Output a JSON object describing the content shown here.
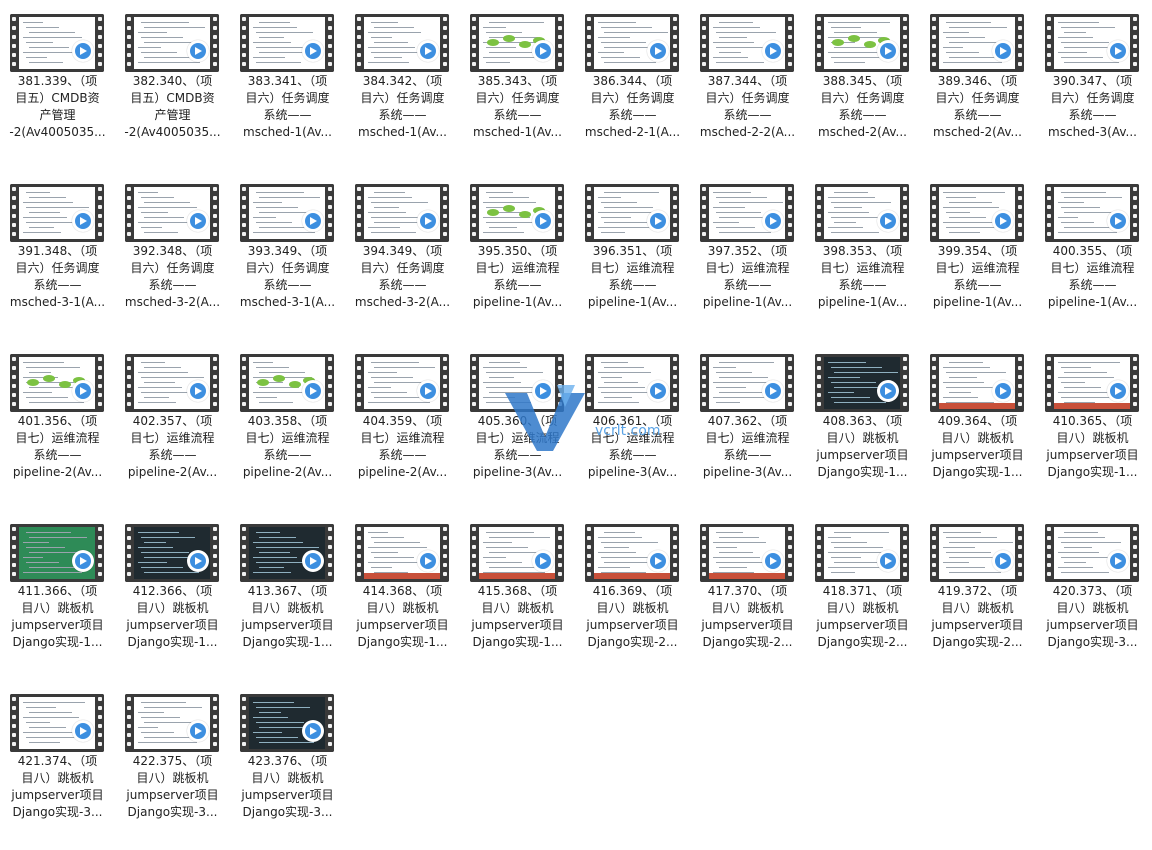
{
  "files": [
    {
      "lines": [
        "381.339、（项",
        "目五）CMDB资",
        "产管理",
        "-2(Av4005035..."
      ]
    },
    {
      "lines": [
        "382.340、（项",
        "目五）CMDB资",
        "产管理",
        "-2(Av4005035..."
      ]
    },
    {
      "lines": [
        "383.341、（项",
        "目六）任务调度",
        "系统——",
        "msched-1(Av..."
      ]
    },
    {
      "lines": [
        "384.342、（项",
        "目六）任务调度",
        "系统——",
        "msched-1(Av..."
      ]
    },
    {
      "lines": [
        "385.343、（项",
        "目六）任务调度",
        "系统——",
        "msched-1(Av..."
      ]
    },
    {
      "lines": [
        "386.344、（项",
        "目六）任务调度",
        "系统——",
        "msched-2-1(A..."
      ]
    },
    {
      "lines": [
        "387.344、（项",
        "目六）任务调度",
        "系统——",
        "msched-2-2(A..."
      ]
    },
    {
      "lines": [
        "388.345、（项",
        "目六）任务调度",
        "系统——",
        "msched-2(Av..."
      ]
    },
    {
      "lines": [
        "389.346、（项",
        "目六）任务调度",
        "系统——",
        "msched-2(Av..."
      ]
    },
    {
      "lines": [
        "390.347、（项",
        "目六）任务调度",
        "系统——",
        "msched-3(Av..."
      ]
    },
    {
      "lines": [
        "391.348、（项",
        "目六）任务调度",
        "系统——",
        "msched-3-1(A..."
      ]
    },
    {
      "lines": [
        "392.348、（项",
        "目六）任务调度",
        "系统——",
        "msched-3-2(A..."
      ]
    },
    {
      "lines": [
        "393.349、（项",
        "目六）任务调度",
        "系统——",
        "msched-3-1(A..."
      ]
    },
    {
      "lines": [
        "394.349、（项",
        "目六）任务调度",
        "系统——",
        "msched-3-2(A..."
      ]
    },
    {
      "lines": [
        "395.350、（项",
        "目七）运维流程",
        "系统——",
        "pipeline-1(Av..."
      ]
    },
    {
      "lines": [
        "396.351、（项",
        "目七）运维流程",
        "系统——",
        "pipeline-1(Av..."
      ]
    },
    {
      "lines": [
        "397.352、（项",
        "目七）运维流程",
        "系统——",
        "pipeline-1(Av..."
      ]
    },
    {
      "lines": [
        "398.353、（项",
        "目七）运维流程",
        "系统——",
        "pipeline-1(Av..."
      ]
    },
    {
      "lines": [
        "399.354、（项",
        "目七）运维流程",
        "系统——",
        "pipeline-1(Av..."
      ]
    },
    {
      "lines": [
        "400.355、（项",
        "目七）运维流程",
        "系统——",
        "pipeline-1(Av..."
      ]
    },
    {
      "lines": [
        "401.356、（项",
        "目七）运维流程",
        "系统——",
        "pipeline-2(Av..."
      ]
    },
    {
      "lines": [
        "402.357、（项",
        "目七）运维流程",
        "系统——",
        "pipeline-2(Av..."
      ]
    },
    {
      "lines": [
        "403.358、（项",
        "目七）运维流程",
        "系统——",
        "pipeline-2(Av..."
      ]
    },
    {
      "lines": [
        "404.359、（项",
        "目七）运维流程",
        "系统——",
        "pipeline-2(Av..."
      ]
    },
    {
      "lines": [
        "405.360、（项",
        "目七）运维流程",
        "系统——",
        "pipeline-3(Av..."
      ]
    },
    {
      "lines": [
        "406.361、（项",
        "目七）运维流程",
        "系统——",
        "pipeline-3(Av..."
      ]
    },
    {
      "lines": [
        "407.362、（项",
        "目七）运维流程",
        "系统——",
        "pipeline-3(Av..."
      ]
    },
    {
      "lines": [
        "408.363、（项",
        "目八）跳板机",
        "jumpserver项目",
        "Django实现-1..."
      ]
    },
    {
      "lines": [
        "409.364、（项",
        "目八）跳板机",
        "jumpserver项目",
        "Django实现-1..."
      ]
    },
    {
      "lines": [
        "410.365、（项",
        "目八）跳板机",
        "jumpserver项目",
        "Django实现-1..."
      ]
    },
    {
      "lines": [
        "411.366、（项",
        "目八）跳板机",
        "jumpserver项目",
        "Django实现-1..."
      ]
    },
    {
      "lines": [
        "412.366、（项",
        "目八）跳板机",
        "jumpserver项目",
        "Django实现-1..."
      ]
    },
    {
      "lines": [
        "413.367、（项",
        "目八）跳板机",
        "jumpserver项目",
        "Django实现-1..."
      ]
    },
    {
      "lines": [
        "414.368、（项",
        "目八）跳板机",
        "jumpserver项目",
        "Django实现-1..."
      ]
    },
    {
      "lines": [
        "415.368、（项",
        "目八）跳板机",
        "jumpserver项目",
        "Django实现-1..."
      ]
    },
    {
      "lines": [
        "416.369、（项",
        "目八）跳板机",
        "jumpserver项目",
        "Django实现-2..."
      ]
    },
    {
      "lines": [
        "417.370、（项",
        "目八）跳板机",
        "jumpserver项目",
        "Django实现-2..."
      ]
    },
    {
      "lines": [
        "418.371、（项",
        "目八）跳板机",
        "jumpserver项目",
        "Django实现-2..."
      ]
    },
    {
      "lines": [
        "419.372、（项",
        "目八）跳板机",
        "jumpserver项目",
        "Django实现-2..."
      ]
    },
    {
      "lines": [
        "420.373、（项",
        "目八）跳板机",
        "jumpserver项目",
        "Django实现-3..."
      ]
    },
    {
      "lines": [
        "421.374、（项",
        "目八）跳板机",
        "jumpserver项目",
        "Django实现-3..."
      ]
    },
    {
      "lines": [
        "422.375、（项",
        "目八）跳板机",
        "jumpserver项目",
        "Django实现-3..."
      ]
    },
    {
      "lines": [
        "423.376、（项",
        "目八）跳板机",
        "jumpserver项目",
        "Django实现-3..."
      ]
    }
  ],
  "watermark": {
    "text": "vcrlt.com"
  },
  "colors": {
    "play_blue": "#3d8fe0",
    "film": "#3a3a3a"
  }
}
